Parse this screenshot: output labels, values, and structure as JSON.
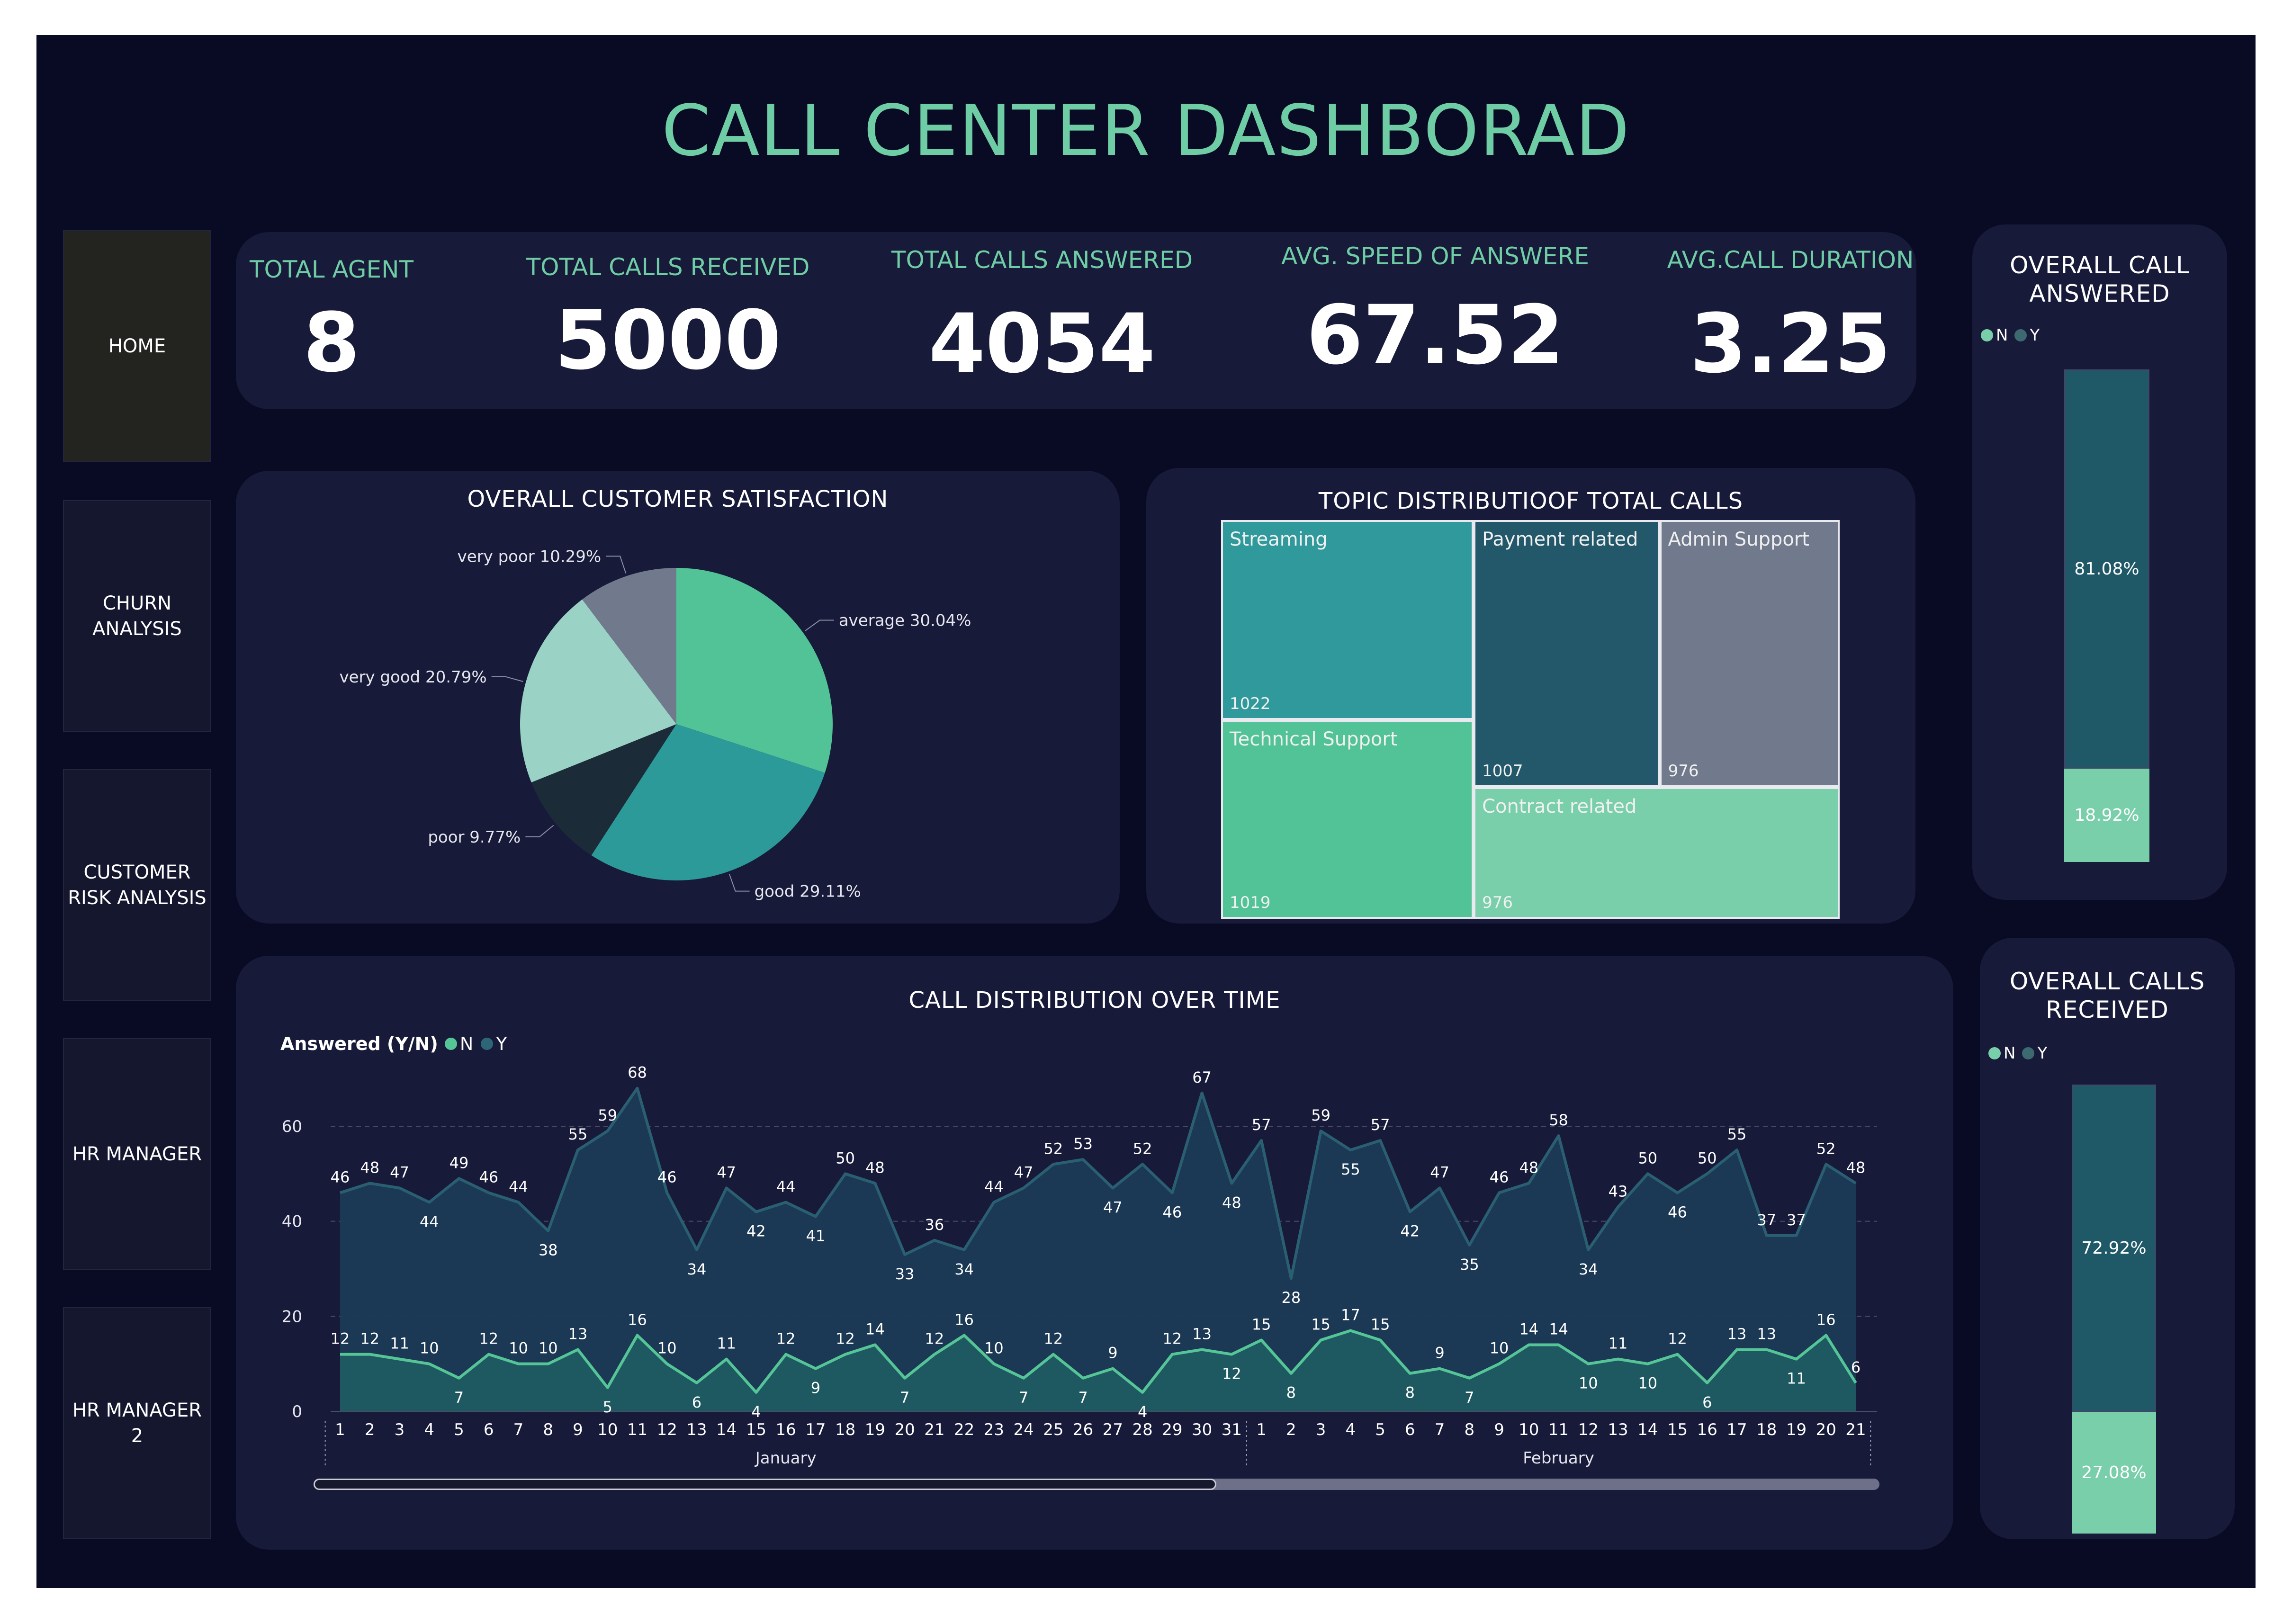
{
  "title": "CALL CENTER DASHBORAD",
  "nav": {
    "items": [
      {
        "label": "HOME"
      },
      {
        "label": "CHURN ANALYSIS"
      },
      {
        "label": "CUSTOMER RISK ANALYSIS"
      },
      {
        "label": "HR MANAGER"
      },
      {
        "label": "HR MANAGER 2"
      }
    ]
  },
  "kpis": [
    {
      "label": "TOTAL AGENT",
      "value": "8"
    },
    {
      "label": "TOTAL CALLS RECEIVED",
      "value": "5000"
    },
    {
      "label": "TOTAL CALLS ANSWERED",
      "value": "4054"
    },
    {
      "label": "AVG. SPEED OF ANSWERE",
      "value": "67.52"
    },
    {
      "label": "AVG.CALL DURATION",
      "value": "3.25"
    }
  ],
  "colors": {
    "accent": "#6fcda5",
    "background": "#090b24",
    "panel": "#181a3a",
    "series_n": "#55c597",
    "series_y": "#1f5866"
  },
  "chart_data": [
    {
      "type": "pie",
      "title": "OVERALL CUSTOMER SATISFACTION",
      "slices": [
        {
          "label": "average",
          "value": 30.04,
          "display": "average 30.04%",
          "color": "#52c397"
        },
        {
          "label": "good",
          "value": 29.11,
          "display": "good 29.11%",
          "color": "#2c9a98"
        },
        {
          "label": "poor",
          "value": 9.77,
          "display": "poor 9.77%",
          "color": "#1c2b38"
        },
        {
          "label": "very good",
          "value": 20.79,
          "display": "very good 20.79%",
          "color": "#9ad2c5"
        },
        {
          "label": "very poor",
          "value": 10.29,
          "display": "very poor 10.29%",
          "color": "#717a8d"
        }
      ]
    },
    {
      "type": "treemap",
      "title": "TOPIC DISTRIBUTIOOF TOTAL CALLS",
      "items": [
        {
          "label": "Streaming",
          "value": 1022,
          "color": "#2f999b"
        },
        {
          "label": "Technical Support",
          "value": 1019,
          "color": "#52c397"
        },
        {
          "label": "Payment related",
          "value": 1007,
          "color": "#22586a"
        },
        {
          "label": "Admin Support",
          "value": 976,
          "color": "#717a8d"
        },
        {
          "label": "Contract related",
          "value": 976,
          "color": "#78cfaa"
        }
      ]
    },
    {
      "type": "stacked-bar",
      "title": "OVERALL CALL ANSWERED",
      "legend": [
        "N",
        "Y"
      ],
      "segments": [
        {
          "label": "Y",
          "value": 81.08,
          "display": "81.08%",
          "color": "#1f5866"
        },
        {
          "label": "N",
          "value": 18.92,
          "display": "18.92%",
          "color": "#78cfaa"
        }
      ]
    },
    {
      "type": "stacked-bar",
      "title": "OVERALL CALLS RECEIVED",
      "legend": [
        "N",
        "Y"
      ],
      "segments": [
        {
          "label": "Y",
          "value": 72.92,
          "display": "72.92%",
          "color": "#1f5866"
        },
        {
          "label": "N",
          "value": 27.08,
          "display": "27.08%",
          "color": "#78cfaa"
        }
      ]
    },
    {
      "type": "area",
      "title": "CALL DISTRIBUTION OVER TIME",
      "legend_title": "Answered (Y/N)",
      "ylim": [
        0,
        60
      ],
      "yticks": [
        0,
        20,
        40,
        60
      ],
      "grid": true,
      "x": [
        "1",
        "2",
        "3",
        "4",
        "5",
        "6",
        "7",
        "8",
        "9",
        "10",
        "11",
        "12",
        "13",
        "14",
        "15",
        "16",
        "17",
        "18",
        "19",
        "20",
        "21",
        "22",
        "23",
        "24",
        "25",
        "26",
        "27",
        "28",
        "29",
        "30",
        "31",
        "1",
        "2",
        "3",
        "4",
        "5",
        "6",
        "7",
        "8",
        "9",
        "10",
        "11",
        "12",
        "13",
        "14",
        "15",
        "16",
        "17",
        "18",
        "19",
        "20",
        "21"
      ],
      "months": [
        {
          "label": "January",
          "start": 0,
          "end": 30
        },
        {
          "label": "February",
          "start": 31,
          "end": 51
        }
      ],
      "series": [
        {
          "name": "Y",
          "values": [
            46,
            48,
            47,
            44,
            49,
            46,
            44,
            38,
            55,
            59,
            68,
            46,
            34,
            47,
            42,
            44,
            41,
            50,
            48,
            33,
            36,
            34,
            44,
            47,
            52,
            53,
            47,
            52,
            46,
            67,
            48,
            57,
            28,
            59,
            55,
            57,
            42,
            47,
            35,
            46,
            48,
            58,
            34,
            43,
            50,
            46,
            50,
            55,
            37,
            37,
            52,
            48
          ]
        },
        {
          "name": "N",
          "values": [
            12,
            12,
            11,
            10,
            7,
            12,
            10,
            10,
            13,
            5,
            16,
            10,
            6,
            11,
            4,
            12,
            9,
            12,
            14,
            7,
            12,
            16,
            10,
            7,
            12,
            7,
            9,
            4,
            12,
            13,
            12,
            15,
            8,
            15,
            17,
            15,
            8,
            9,
            7,
            10,
            14,
            14,
            10,
            11,
            10,
            12,
            6,
            13,
            13,
            11,
            16,
            6
          ]
        }
      ]
    }
  ]
}
